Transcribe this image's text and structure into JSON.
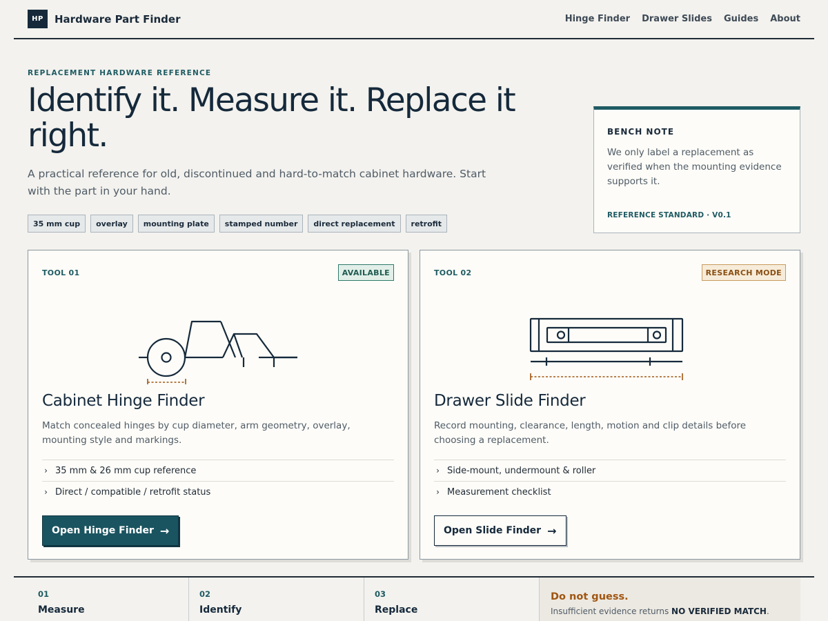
{
  "brand": {
    "logo": "HP",
    "name": "Hardware Part Finder"
  },
  "nav": [
    "Hinge Finder",
    "Drawer Slides",
    "Guides",
    "About"
  ],
  "hero": {
    "eyebrow": "REPLACEMENT HARDWARE REFERENCE",
    "title": "Identify it. Measure it. Replace it right.",
    "subtitle": "A practical reference for old, discontinued and hard-to-match cabinet hardware. Start with the part in your hand.",
    "tags": [
      "35 mm cup",
      "overlay",
      "mounting plate",
      "stamped number",
      "direct replacement",
      "retrofit"
    ]
  },
  "bench_note": {
    "title": "BENCH NOTE",
    "text": "We only label a replacement as verified when the mounting evidence supports it.",
    "standard": "REFERENCE STANDARD · V0.1"
  },
  "tools": [
    {
      "label": "TOOL 01",
      "badge": "AVAILABLE",
      "title": "Cabinet Hinge Finder",
      "description": "Match concealed hinges by cup diameter, arm geometry, overlay, mounting style and markings.",
      "features": [
        "35 mm & 26 mm cup reference",
        "Direct / compatible / retrofit status"
      ],
      "button": "Open Hinge Finder",
      "illustration": "hinge-diagram-icon"
    },
    {
      "label": "TOOL 02",
      "badge": "RESEARCH MODE",
      "title": "Drawer Slide Finder",
      "description": "Record mounting, clearance, length, motion and clip details before choosing a replacement.",
      "features": [
        "Side-mount, undermount & roller",
        "Measurement checklist"
      ],
      "button": "Open Slide Finder",
      "illustration": "drawer-slide-diagram-icon"
    }
  ],
  "steps": [
    {
      "num": "01",
      "name": "Measure"
    },
    {
      "num": "02",
      "name": "Identify"
    },
    {
      "num": "03",
      "name": "Replace"
    }
  ],
  "warning": {
    "title": "Do not guess.",
    "text_prefix": "Insufficient evidence returns ",
    "text_strong": "NO VERIFIED MATCH",
    "text_suffix": "."
  },
  "colors": {
    "accent": "#1f5b63",
    "navy": "#15293b",
    "available": "#2e7a6a",
    "research": "#8a4f14",
    "warning": "#a05511"
  }
}
